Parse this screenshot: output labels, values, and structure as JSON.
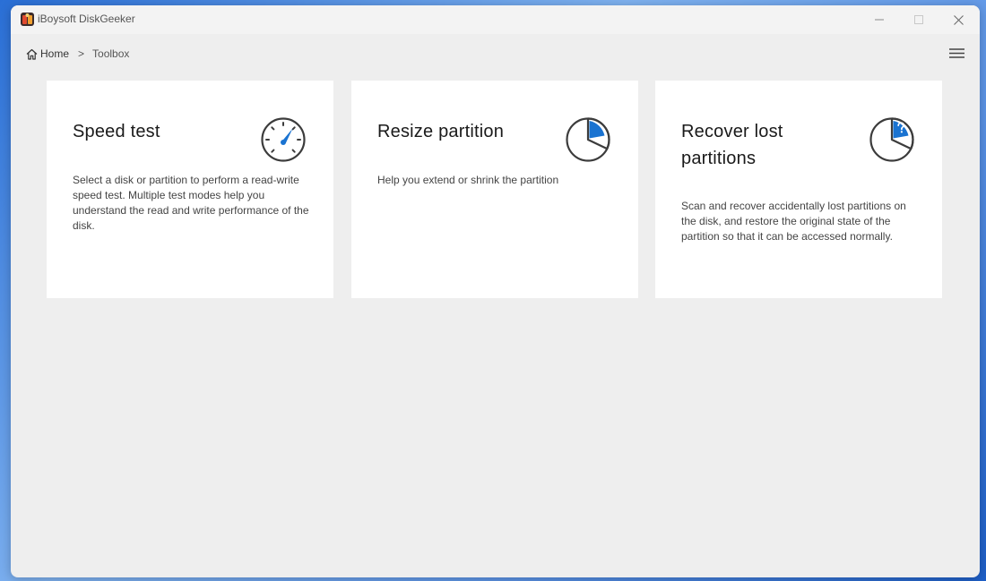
{
  "app": {
    "title": "iBoysoft DiskGeeker",
    "brand_color": "#e04a2f"
  },
  "window_controls": {
    "minimize_icon": "minimize-icon",
    "maximize_icon": "maximize-icon",
    "close_icon": "close-icon"
  },
  "breadcrumb": {
    "home": "Home",
    "separator": ">",
    "current": "Toolbox"
  },
  "toolbar": {
    "menu_icon": "hamburger-menu-icon"
  },
  "accent_color": "#1a73d1",
  "cards": [
    {
      "title": "Speed test",
      "description": "Select a disk or partition to perform a read-write speed test. Multiple test modes help you understand the read and write performance of the disk.",
      "icon": "speedometer-icon"
    },
    {
      "title": "Resize partition",
      "description": "Help you extend or shrink the partition",
      "icon": "pie-chart-icon"
    },
    {
      "title": "Recover lost partitions",
      "description": "Scan and recover accidentally lost partitions on the disk, and restore the original state of the partition so that it can be accessed normally.",
      "icon": "pie-chart-question-icon"
    }
  ]
}
